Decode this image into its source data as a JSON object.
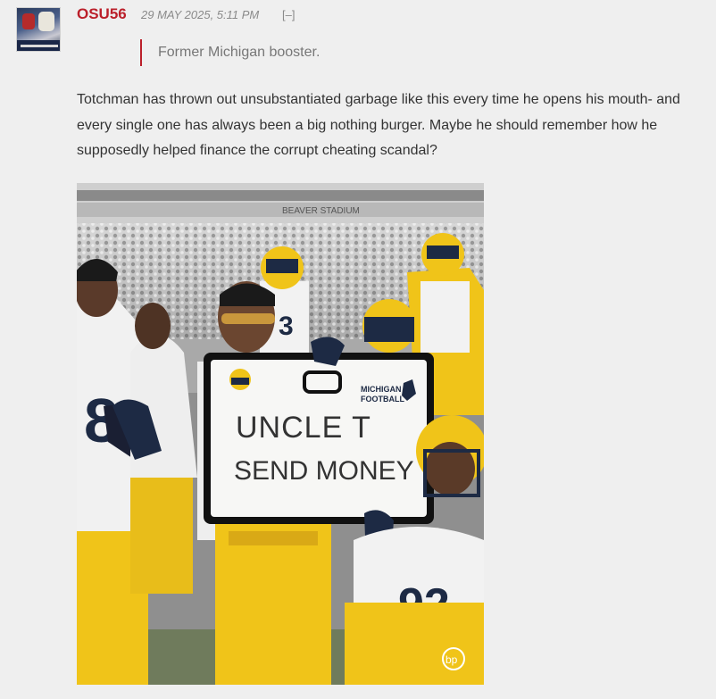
{
  "comment": {
    "username": "OSU56",
    "timestamp": "29 MAY 2025, 5:11 PM",
    "collapse_label": "[–]",
    "quote": "Former Michigan booster.",
    "body": "Totchman has thrown out unsubstantiated garbage like this every time he opens his mouth- and every single one has always been a big nothing burger. Maybe he should remember how he supposedly helped finance the corrupt cheating scandal?"
  },
  "photo": {
    "sign_line1": "UNCLE T",
    "sign_line2": "SEND MONEY",
    "sign_brand_line1": "MICHIGAN",
    "sign_brand_line2": "FOOTBALL",
    "jersey_left": "8",
    "jersey_mid": "3",
    "jersey_right": "92",
    "stadium_banner": "BEAVER STADIUM",
    "watermark": "bp"
  },
  "colors": {
    "accent": "#bb1f2a",
    "maize": "#f0c419",
    "navy": "#1d2a44"
  }
}
